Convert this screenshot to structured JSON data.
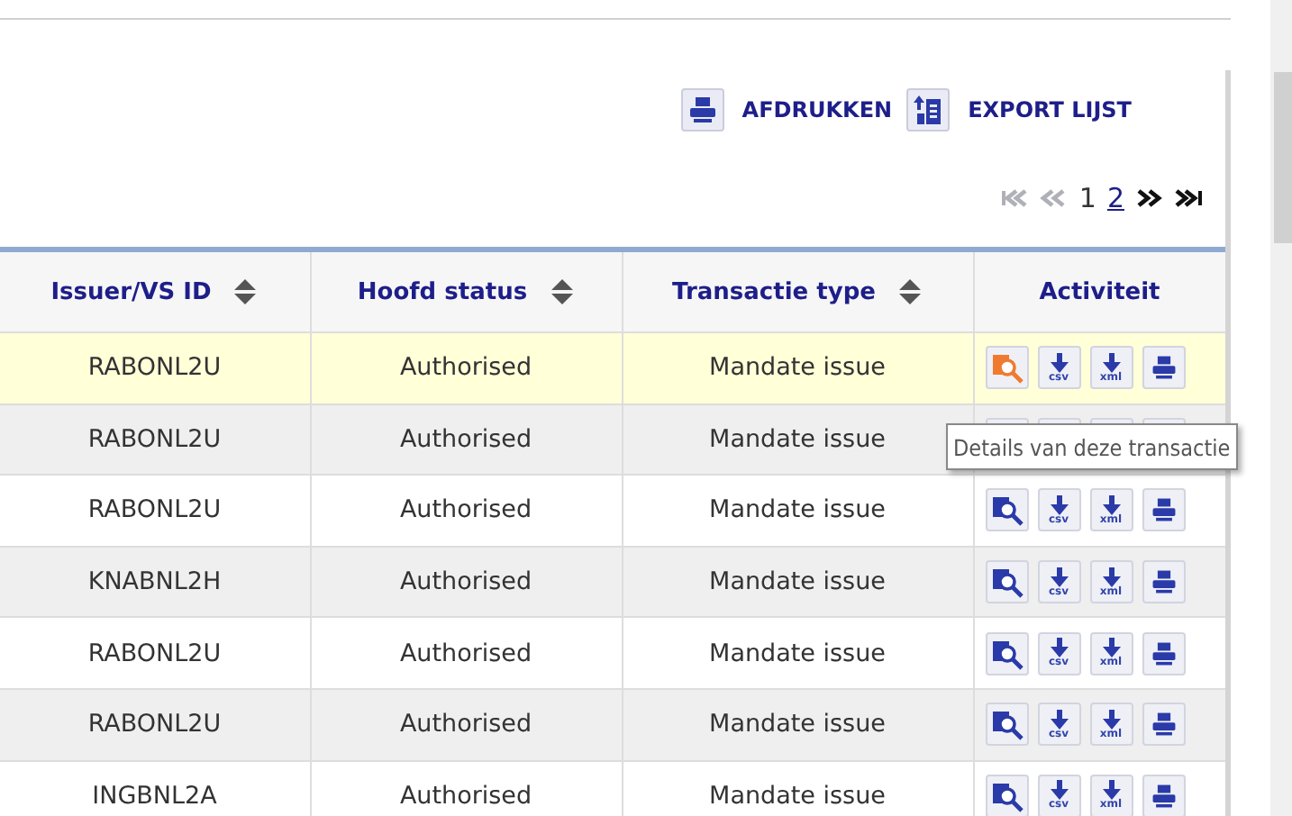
{
  "toolbar": {
    "print_label": "AFDRUKKEN",
    "export_label": "EXPORT LIJST"
  },
  "pager": {
    "nav": [
      {
        "kind": "first",
        "disabled": true
      },
      {
        "kind": "prev",
        "disabled": true
      },
      {
        "kind": "next",
        "disabled": false
      },
      {
        "kind": "last",
        "disabled": false
      }
    ],
    "pages": [
      {
        "label": "1",
        "selected": true
      },
      {
        "label": "2",
        "selected": false
      }
    ]
  },
  "table": {
    "columns": [
      {
        "label": "Issuer/VS ID",
        "sortable": true
      },
      {
        "label": "Hoofd status",
        "sortable": true
      },
      {
        "label": "Transactie type",
        "sortable": true
      },
      {
        "label": "Activiteit",
        "sortable": false
      }
    ],
    "rows": [
      {
        "issuer": "RABONL2U",
        "status": "Authorised",
        "type": "Mandate issue",
        "highlighted": true,
        "downloads": [
          "csv",
          "xml"
        ]
      },
      {
        "issuer": "RABONL2U",
        "status": "Authorised",
        "type": "Mandate issue",
        "highlighted": false
      },
      {
        "issuer": "RABONL2U",
        "status": "Authorised",
        "type": "Mandate issue",
        "highlighted": false,
        "downloads": [
          "csv",
          "xml"
        ]
      },
      {
        "issuer": "KNABNL2H",
        "status": "Authorised",
        "type": "Mandate issue",
        "highlighted": false,
        "downloads": [
          "csv",
          "xml"
        ]
      },
      {
        "issuer": "RABONL2U",
        "status": "Authorised",
        "type": "Mandate issue",
        "highlighted": false,
        "downloads": [
          "csv",
          "xml"
        ]
      },
      {
        "issuer": "RABONL2U",
        "status": "Authorised",
        "type": "Mandate issue",
        "highlighted": false,
        "downloads": [
          "csv",
          "xml"
        ]
      },
      {
        "issuer": "INGBNL2A",
        "status": "Authorised",
        "type": "Mandate issue",
        "highlighted": false,
        "downloads": [
          "csv",
          "xml"
        ]
      }
    ]
  },
  "tooltip": {
    "text": "Details van deze transactie"
  }
}
